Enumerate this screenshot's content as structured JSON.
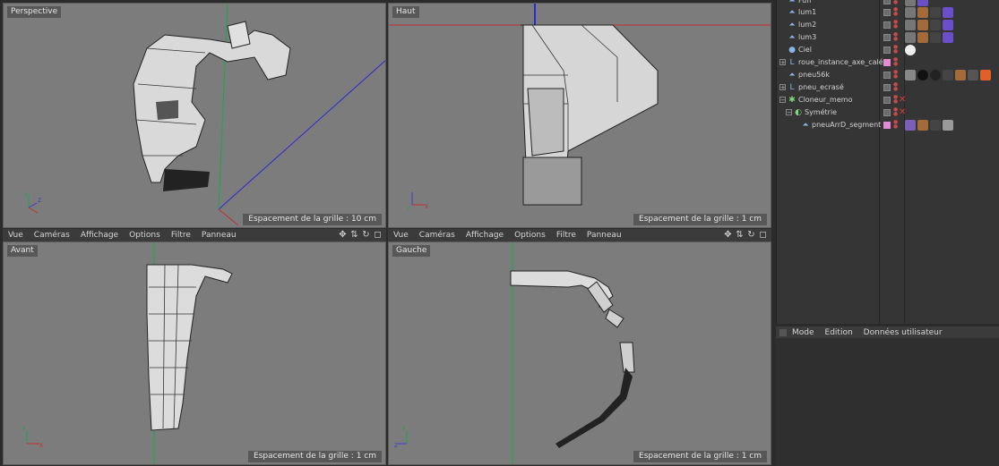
{
  "viewports": {
    "perspective": {
      "label": "Perspective",
      "grid": "Espacement de la grille : 10 cm"
    },
    "haut": {
      "label": "Haut",
      "grid": "Espacement de la grille : 1 cm"
    },
    "avant": {
      "label": "Avant",
      "grid": "Espacement de la grille : 1 cm"
    },
    "gauche": {
      "label": "Gauche",
      "grid": "Espacement de la grille : 1 cm"
    }
  },
  "viewport_menu": [
    "Vue",
    "Caméras",
    "Affichage",
    "Options",
    "Filtre",
    "Panneau"
  ],
  "objects": [
    {
      "name": "Fun"
    },
    {
      "name": "lum1"
    },
    {
      "name": "lum2"
    },
    {
      "name": "lum3"
    },
    {
      "name": "Ciel"
    },
    {
      "name": "roue_instance_axe_calée"
    },
    {
      "name": "pneu56k"
    },
    {
      "name": "pneu_ecrasé"
    },
    {
      "name": "Cloneur_memo"
    },
    {
      "name": "Symétrie"
    },
    {
      "name": "pneuArrD_segment"
    }
  ],
  "attr_menu": [
    "Mode",
    "Edition",
    "Données utilisateur"
  ],
  "axis_labels": {
    "x": "X",
    "y": "Y",
    "z": "Z"
  }
}
